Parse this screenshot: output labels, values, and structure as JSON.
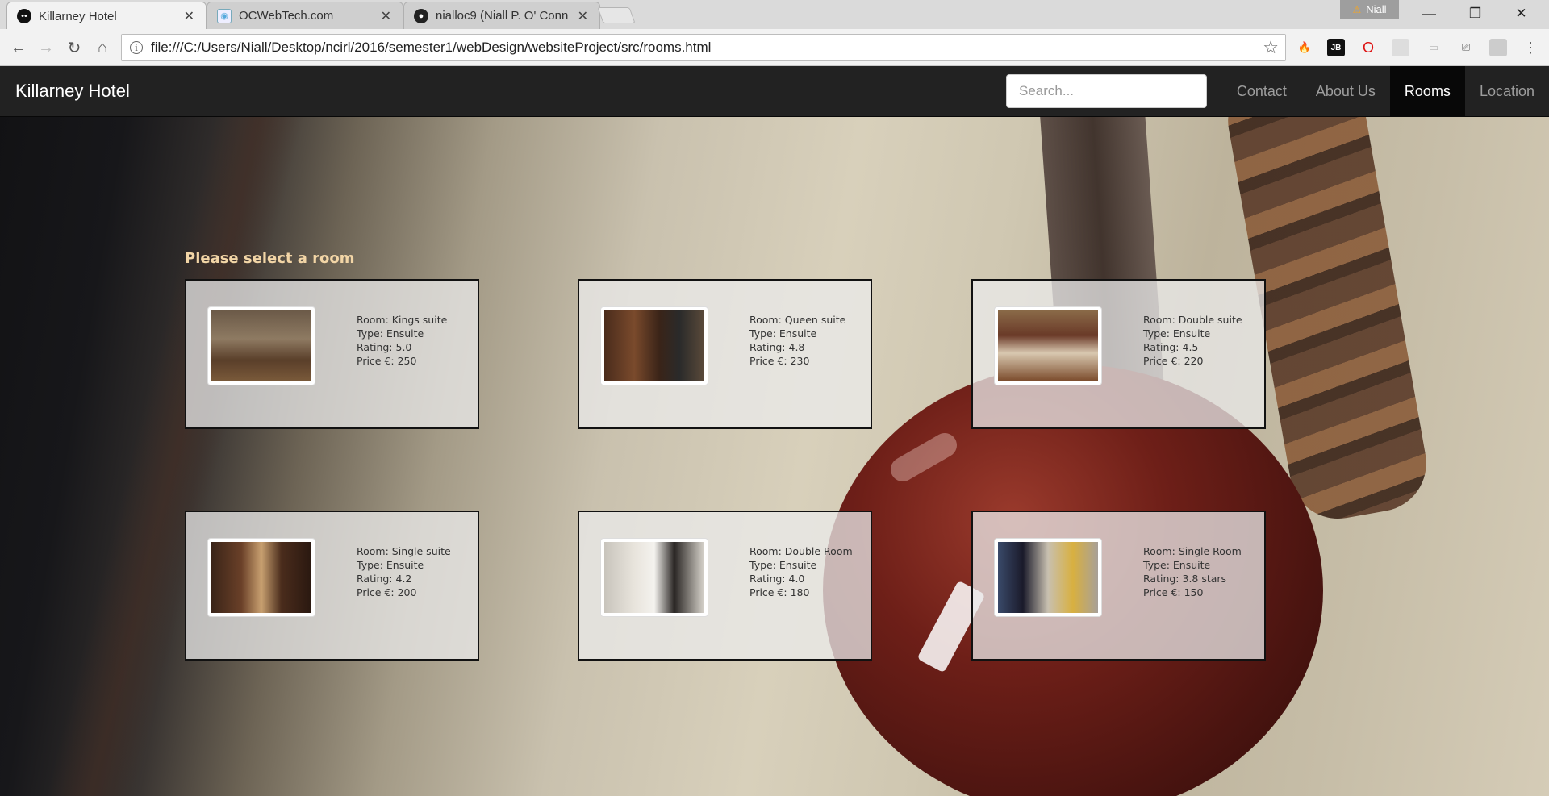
{
  "browser": {
    "tabs": [
      {
        "title": "Killarney Hotel",
        "favicon": "killarney-favicon",
        "active": true
      },
      {
        "title": "OCWebTech.com",
        "favicon": "ocwebtech-favicon",
        "active": false
      },
      {
        "title": "nialloc9 (Niall P. O' Conn",
        "favicon": "github-icon",
        "active": false
      }
    ],
    "profile_name": "Niall",
    "url": "file:///C:/Users/Niall/Desktop/ncirl/2016/semester1/webDesign/websiteProject/src/rooms.html"
  },
  "site": {
    "brand": "Killarney Hotel",
    "search_placeholder": "Search...",
    "nav": [
      {
        "label": "Contact",
        "active": false
      },
      {
        "label": "About Us",
        "active": false
      },
      {
        "label": "Rooms",
        "active": true
      },
      {
        "label": "Location",
        "active": false
      }
    ],
    "heading": "Please select a room",
    "rooms": [
      {
        "room": "Room: Kings suite",
        "type": "Type: Ensuite",
        "rating": "Rating: 5.0",
        "price": "Price €: 250"
      },
      {
        "room": "Room: Queen suite",
        "type": "Type: Ensuite",
        "rating": "Rating: 4.8",
        "price": "Price €: 230"
      },
      {
        "room": "Room: Double suite",
        "type": "Type: Ensuite",
        "rating": "Rating: 4.5",
        "price": "Price €: 220"
      },
      {
        "room": "Room: Single suite",
        "type": "Type: Ensuite",
        "rating": "Rating: 4.2",
        "price": "Price €: 200"
      },
      {
        "room": "Room: Double Room",
        "type": "Type: Ensuite",
        "rating": "Rating: 4.0",
        "price": "Price €: 180"
      },
      {
        "room": "Room: Single Room",
        "type": "Type: Ensuite",
        "rating": "Rating: 3.8 stars",
        "price": "Price €: 150"
      }
    ]
  },
  "colors": {
    "navbar_bg": "#222222",
    "nav_active_bg": "#080808",
    "heading": "#f2d5a6"
  }
}
